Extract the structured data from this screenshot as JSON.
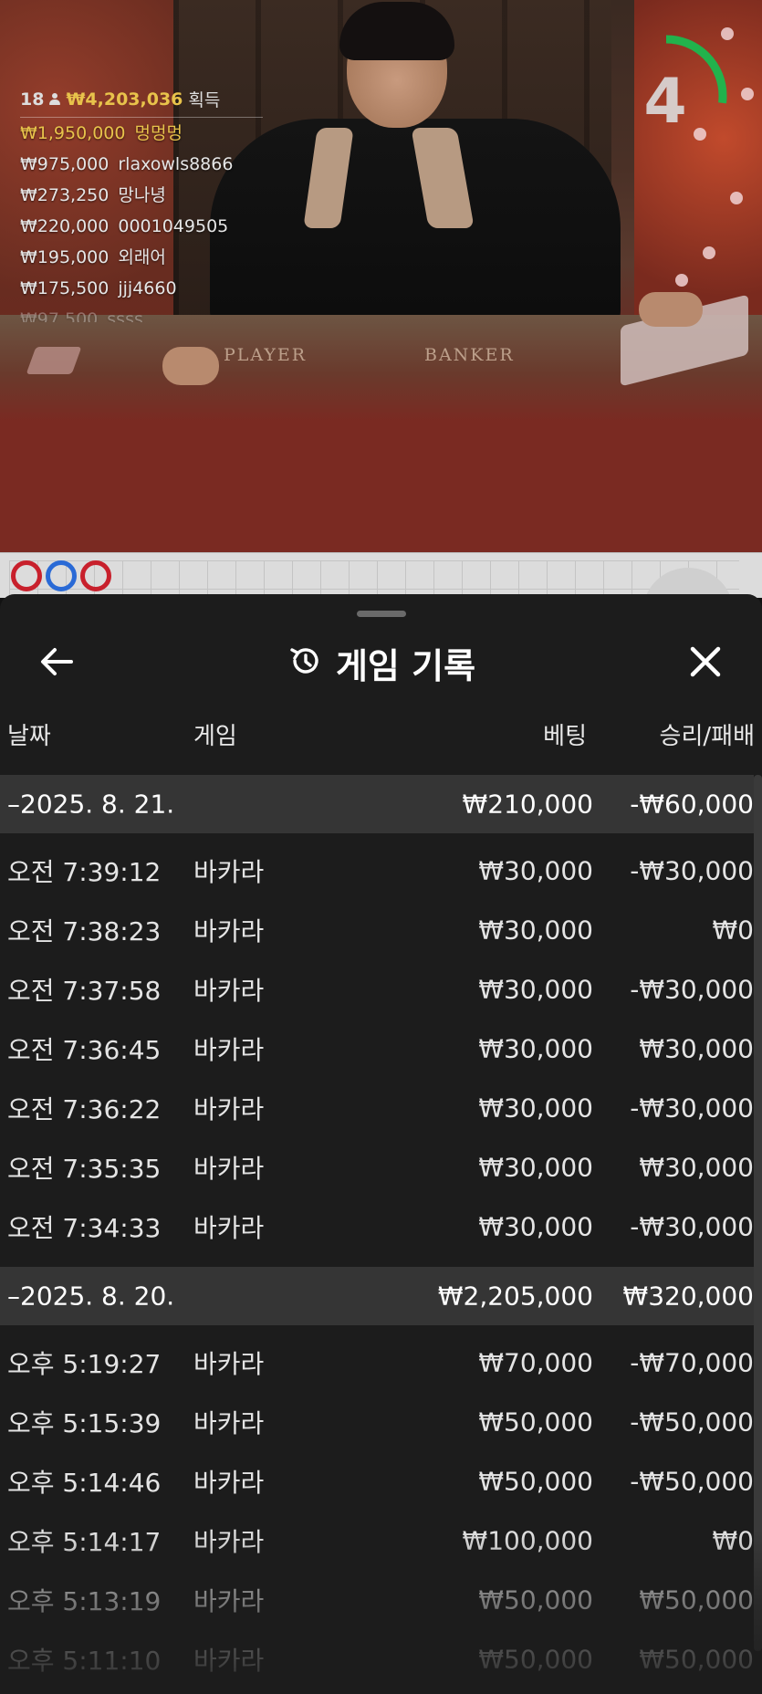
{
  "video": {
    "table_labels": {
      "player": "PLAYER",
      "banker": "BANKER"
    },
    "timer": {
      "seconds": "4",
      "fraction_remaining": 0.27
    },
    "leaderboard": {
      "count": "18",
      "total": "₩4,203,036",
      "suffix": "획득",
      "entries": [
        {
          "amount": "₩1,950,000",
          "name": "멍멍멍"
        },
        {
          "amount": "₩975,000",
          "name": "rlaxowls8866"
        },
        {
          "amount": "₩273,250",
          "name": "망나녕"
        },
        {
          "amount": "₩220,000",
          "name": "0001049505"
        },
        {
          "amount": "₩195,000",
          "name": "외래어"
        },
        {
          "amount": "₩175,500",
          "name": "jjj4660"
        },
        {
          "amount": "₩97,500",
          "name": "ssss"
        }
      ]
    }
  },
  "history": {
    "title": "게임 기록",
    "columns": {
      "date": "날짜",
      "game": "게임",
      "bet": "베팅",
      "result": "승리/패배"
    },
    "groups": [
      {
        "date": "–2025. 8. 21.",
        "bet_total": "₩210,000",
        "result_total": "-₩60,000",
        "rows": [
          {
            "time": "오전 7:39:12",
            "game": "바카라",
            "bet": "₩30,000",
            "result": "-₩30,000"
          },
          {
            "time": "오전 7:38:23",
            "game": "바카라",
            "bet": "₩30,000",
            "result": "₩0"
          },
          {
            "time": "오전 7:37:58",
            "game": "바카라",
            "bet": "₩30,000",
            "result": "-₩30,000"
          },
          {
            "time": "오전 7:36:45",
            "game": "바카라",
            "bet": "₩30,000",
            "result": "₩30,000"
          },
          {
            "time": "오전 7:36:22",
            "game": "바카라",
            "bet": "₩30,000",
            "result": "-₩30,000"
          },
          {
            "time": "오전 7:35:35",
            "game": "바카라",
            "bet": "₩30,000",
            "result": "₩30,000"
          },
          {
            "time": "오전 7:34:33",
            "game": "바카라",
            "bet": "₩30,000",
            "result": "-₩30,000"
          }
        ]
      },
      {
        "date": "–2025. 8. 20.",
        "bet_total": "₩2,205,000",
        "result_total": "₩320,000",
        "rows": [
          {
            "time": "오후 5:19:27",
            "game": "바카라",
            "bet": "₩70,000",
            "result": "-₩70,000"
          },
          {
            "time": "오후 5:15:39",
            "game": "바카라",
            "bet": "₩50,000",
            "result": "-₩50,000"
          },
          {
            "time": "오후 5:14:46",
            "game": "바카라",
            "bet": "₩50,000",
            "result": "-₩50,000"
          },
          {
            "time": "오후 5:14:17",
            "game": "바카라",
            "bet": "₩100,000",
            "result": "₩0"
          },
          {
            "time": "오후 5:13:19",
            "game": "바카라",
            "bet": "₩50,000",
            "result": "₩50,000"
          },
          {
            "time": "오후 5:11:10",
            "game": "바카라",
            "bet": "₩50,000",
            "result": "₩50,000"
          }
        ]
      }
    ]
  },
  "colors": {
    "sheet_bg": "#1c1c1c",
    "date_row_bg": "#353535",
    "leader_gold": "#e8c34b",
    "timer_green": "#22b24c",
    "road_red": "#c8202c",
    "road_blue": "#2a6ad6"
  },
  "icons": {
    "back": "arrow-left-icon",
    "history": "history-clock-icon",
    "close": "close-icon",
    "person": "person-icon"
  }
}
